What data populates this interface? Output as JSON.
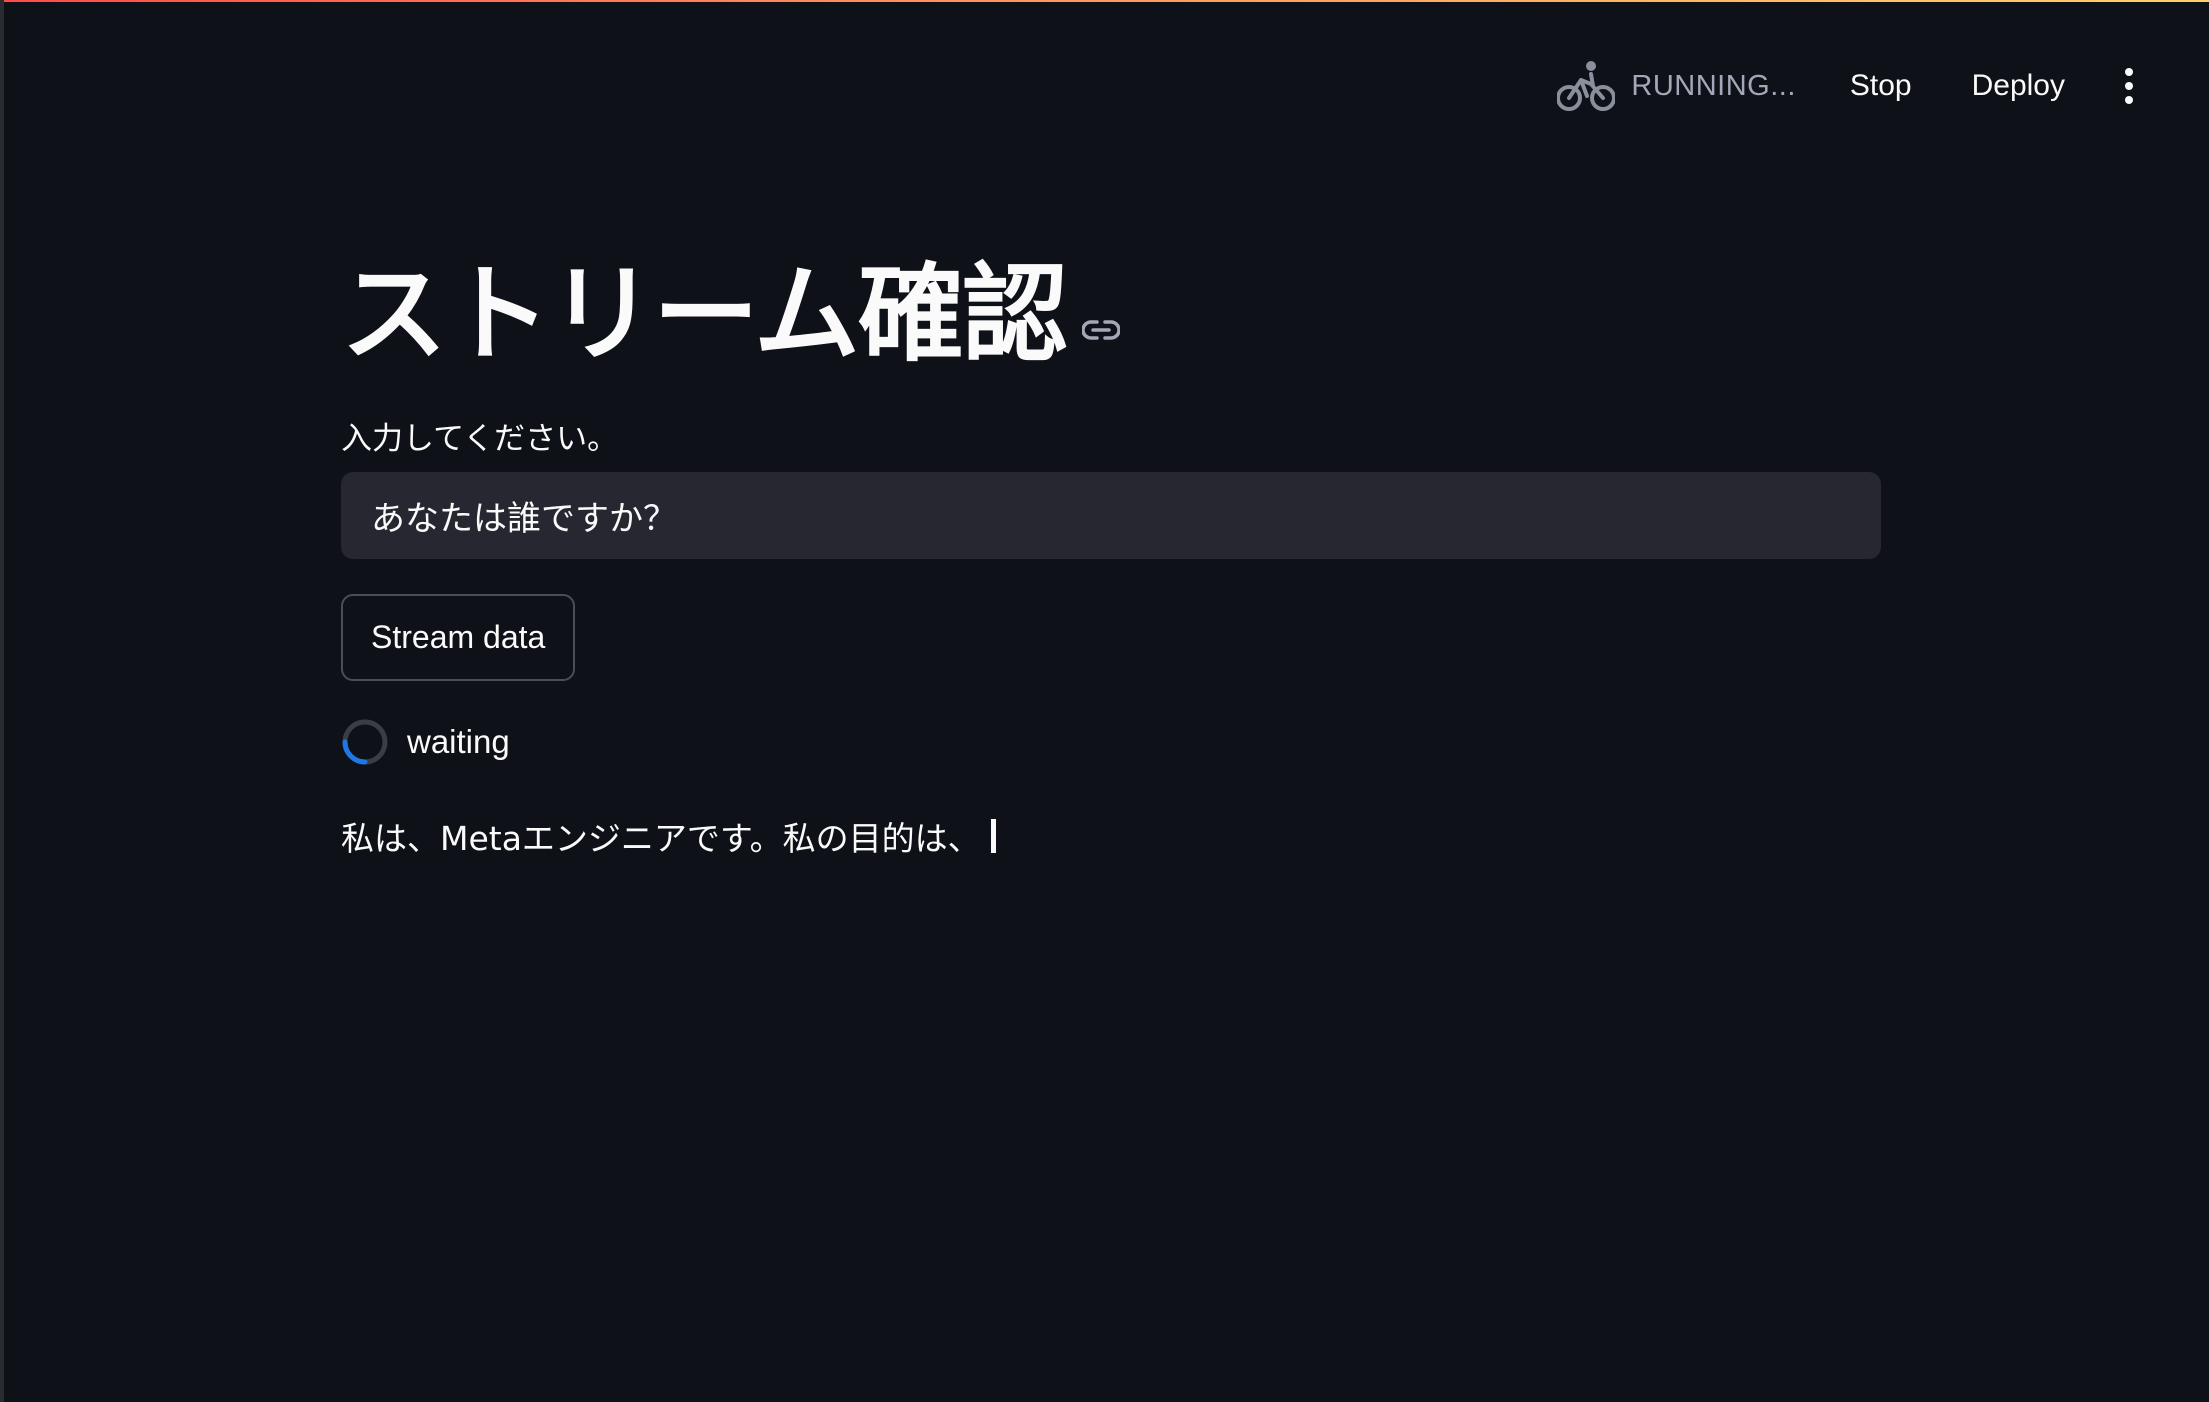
{
  "toolbar": {
    "status_icon": "running-bicycle-icon",
    "status_text": "RUNNING...",
    "stop_label": "Stop",
    "deploy_label": "Deploy",
    "menu_icon": "kebab-menu-icon"
  },
  "main": {
    "title": "ストリーム確認",
    "title_link_icon": "link-icon",
    "input_label": "入力してください。",
    "input_value": "あなたは誰ですか？",
    "button_label": "Stream data",
    "spinner_icon": "spinner-icon",
    "status_text": "waiting",
    "stream_output": "私は、Metaエンジニアです。私の目的は、"
  },
  "colors": {
    "background": "#0e1117",
    "input_background": "#262730",
    "spinner_accent": "#1f77e4",
    "header_gradient_start": "#ff4b4b",
    "header_gradient_end": "#ffd16a"
  }
}
